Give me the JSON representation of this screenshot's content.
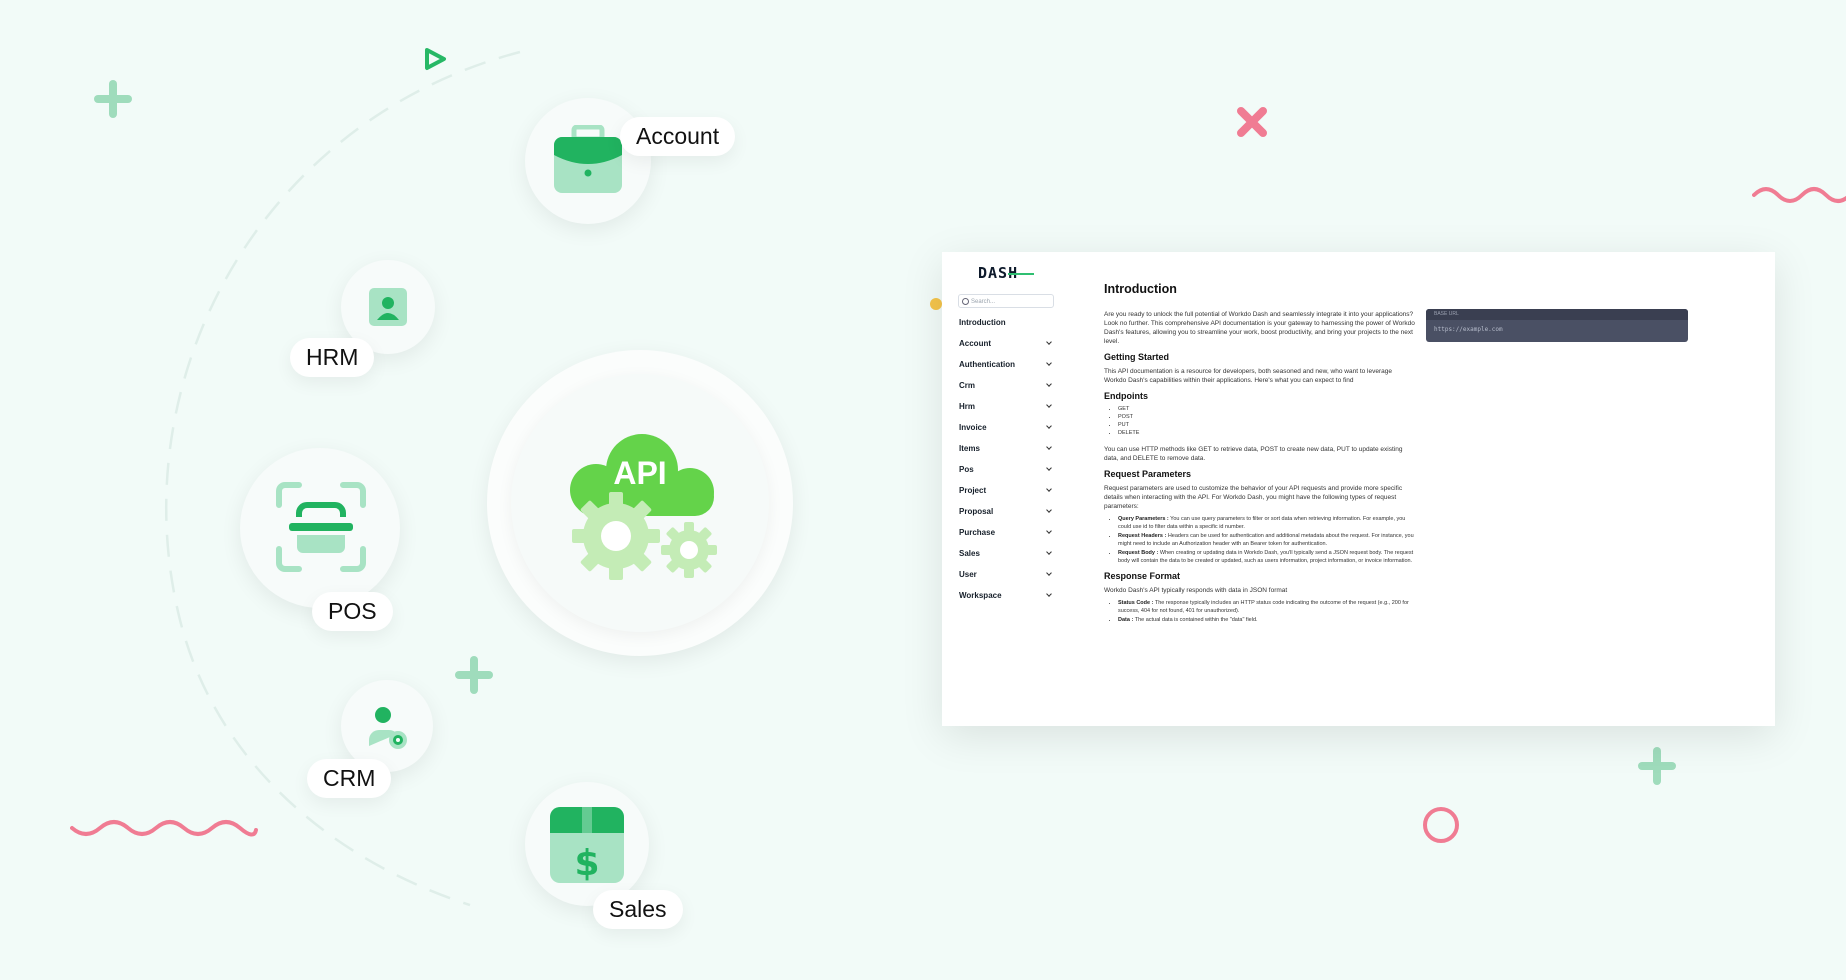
{
  "hero": {
    "center_badge": "API",
    "modules": [
      {
        "label": "Account",
        "icon": "briefcase-icon"
      },
      {
        "label": "HRM",
        "icon": "user-card-icon"
      },
      {
        "label": "POS",
        "icon": "scanner-icon"
      },
      {
        "label": "CRM",
        "icon": "user-eye-icon"
      },
      {
        "label": "Sales",
        "icon": "dollar-box-icon"
      }
    ]
  },
  "colors": {
    "brand_green": "#21b360",
    "light_green": "#a8e3c4",
    "api_green": "#64d34a",
    "accent_pink": "#f07c93"
  },
  "docs": {
    "logo": "DASH",
    "search_placeholder": "Search...",
    "nav": [
      "Introduction",
      "Account",
      "Authentication",
      "Crm",
      "Hrm",
      "Invoice",
      "Items",
      "Pos",
      "Project",
      "Proposal",
      "Purchase",
      "Sales",
      "User",
      "Workspace"
    ],
    "title": "Introduction",
    "intro": "Are you ready to unlock the full potential of Workdo Dash and seamlessly integrate it into your applications? Look no further. This comprehensive API documentation is your gateway to harnessing the power of Workdo Dash's features, allowing you to streamline your work, boost productivity, and bring your projects to the next level.",
    "getting_started_title": "Getting Started",
    "getting_started_text": "This API documentation is a resource for developers, both seasoned and new, who want to leverage Workdo Dash's capabilities within their applications. Here's what you can expect to find",
    "endpoints_title": "Endpoints",
    "endpoints": [
      "GET",
      "POST",
      "PUT",
      "DELETE"
    ],
    "endpoints_text": "You can use HTTP methods like GET to retrieve data, POST to create new data, PUT to update existing data, and DELETE to remove data.",
    "request_params_title": "Request Parameters",
    "request_params_text": "Request parameters are used to customize the behavior of your API requests and provide more specific details when interacting with the API. For Workdo Dash, you might have the following types of request parameters:",
    "params": [
      {
        "name": "Query Parameters :",
        "text": " You can use query parameters to filter or sort data when retrieving information. For example, you could use id to filter data within a specific id number."
      },
      {
        "name": "Request Headers :",
        "text": " Headers can be used for authentication and additional metadata about the request. For instance, you might need to include an Authorization header with an Bearer token for authentication."
      },
      {
        "name": "Request Body :",
        "text": " When creating or updating data in Workdo Dash, you'll typically send a JSON request body. The request body will contain the data to be created or updated, such as users information, project information, or invoice information."
      }
    ],
    "response_title": "Response Format",
    "response_text": "Workdo Dash's API typically responds with data in JSON format",
    "response_items": [
      {
        "name": "Status Code :",
        "text": " The response typically includes an HTTP status code indicating the outcome of the request (e.g., 200 for success, 404 for not found, 401 for unauthorized)."
      },
      {
        "name": "Data :",
        "text": " The actual data is contained within the \"data\" field."
      }
    ],
    "code_label": "BASE URL",
    "base_url": "https://example.com"
  }
}
